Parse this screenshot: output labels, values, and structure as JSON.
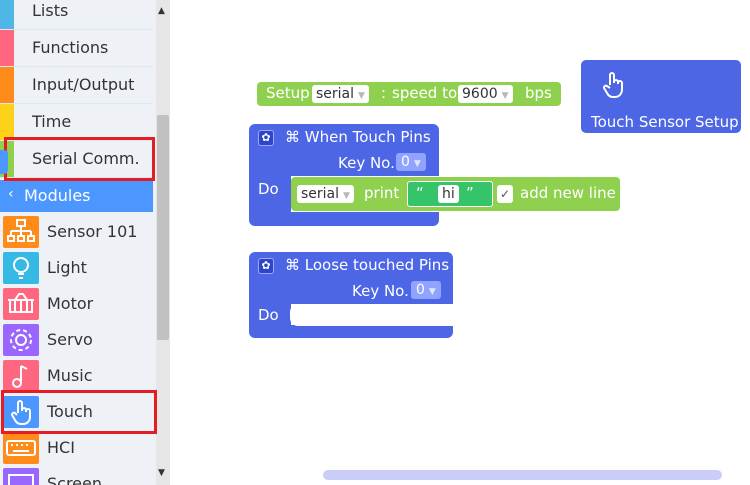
{
  "categories": [
    {
      "label": "Lists",
      "color": "#4fb7e5"
    },
    {
      "label": "Functions",
      "color": "#ff6680"
    },
    {
      "label": "Input/Output",
      "color": "#ff8c1a"
    },
    {
      "label": "Time",
      "color": "#ffd21a"
    },
    {
      "label": "Serial Comm.",
      "color": "#8fd14f"
    }
  ],
  "modules_header": {
    "label": "Modules",
    "chevron": "‹"
  },
  "modules": [
    {
      "label": "Sensor 101",
      "icon": "network-icon",
      "color": "#ff8c1a"
    },
    {
      "label": "Light",
      "icon": "bulb-icon",
      "color": "#36b9e4"
    },
    {
      "label": "Motor",
      "icon": "basket-icon",
      "color": "#ff6680"
    },
    {
      "label": "Servo",
      "icon": "gear-icon",
      "color": "#9966ff"
    },
    {
      "label": "Music",
      "icon": "music-note-icon",
      "color": "#ff6680"
    },
    {
      "label": "Touch",
      "icon": "hand-pointer-icon",
      "color": "#4c97ff"
    },
    {
      "label": "HCI",
      "icon": "keyboard-icon",
      "color": "#ff8c1a"
    },
    {
      "label": "Screen",
      "icon": "monitor-icon",
      "color": "#9966ff"
    }
  ],
  "setup_block": {
    "prefix": "Setup",
    "port": "serial",
    "colon": ":",
    "speed_label": "speed to",
    "baud": "9600",
    "unit": "bps"
  },
  "touch_sensor_setup": {
    "label": "Touch Sensor Setup"
  },
  "when_touch": {
    "title": "⌘ When Touch Pins",
    "key_label": "Key No.",
    "key_value": "0",
    "do_label": "Do",
    "print_block": {
      "port": "serial",
      "print_label": "print",
      "quote_open": "“",
      "text": "hi",
      "quote_close": "”",
      "check": "✓",
      "newline_label": "add new line"
    }
  },
  "loose_touch": {
    "title": "⌘ Loose touched Pins",
    "key_label": "Key No.",
    "key_value": "0",
    "do_label": "Do"
  },
  "colors": {
    "accent": "#4c97ff",
    "highlight": "#e51c23",
    "block_blue": "#4c66e6",
    "block_green": "#8fd14f"
  }
}
